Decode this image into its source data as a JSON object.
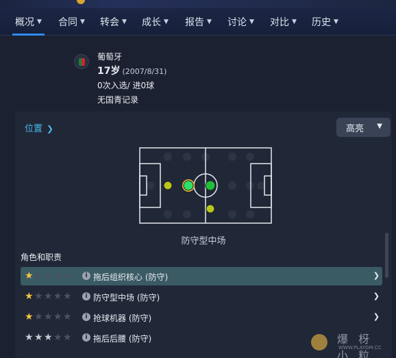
{
  "nav": {
    "items": [
      {
        "label": "概况",
        "active": true
      },
      {
        "label": "合同",
        "active": false
      },
      {
        "label": "转会",
        "active": false
      },
      {
        "label": "成长",
        "active": false
      },
      {
        "label": "报告",
        "active": false
      },
      {
        "label": "讨论",
        "active": false
      },
      {
        "label": "对比",
        "active": false
      },
      {
        "label": "历史",
        "active": false
      }
    ]
  },
  "player": {
    "nationality": "葡萄牙",
    "age": "17岁",
    "birth_date": "(2007/8/31)",
    "caps": "0次入选/ 进0球",
    "youth_record": "无国青记录"
  },
  "position_panel": {
    "link_label": "位置",
    "highlight_label": "高亮",
    "pitch_caption": "防守型中场",
    "pitch_markers": [
      {
        "role": "best",
        "color": "#2ee06a"
      },
      {
        "role": "good",
        "color": "#1fbf3a"
      },
      {
        "role": "ok",
        "color": "#b8c61a"
      },
      {
        "role": "ok",
        "color": "#b8c61a"
      }
    ]
  },
  "roles": {
    "title": "角色和职责",
    "items": [
      {
        "name": "拖后组织核心 (防守)",
        "stars": 1,
        "star_color": "#f4c542",
        "selected": true
      },
      {
        "name": "防守型中场 (防守)",
        "stars": 1,
        "star_color": "#f4c542",
        "selected": false
      },
      {
        "name": "抢球机器 (防守)",
        "stars": 1,
        "star_color": "#f4c542",
        "selected": false
      },
      {
        "name": "拖后后腰 (防守)",
        "stars": 3,
        "star_color": "#c7cbd2",
        "selected": false
      }
    ]
  },
  "watermark": {
    "text": "爆 枒 小 粒",
    "url": "WWW.PLAYGM.CC"
  },
  "colors": {
    "accent": "#2d8cf0",
    "link": "#4ab6e8",
    "selected_row": "#3a5a64"
  }
}
